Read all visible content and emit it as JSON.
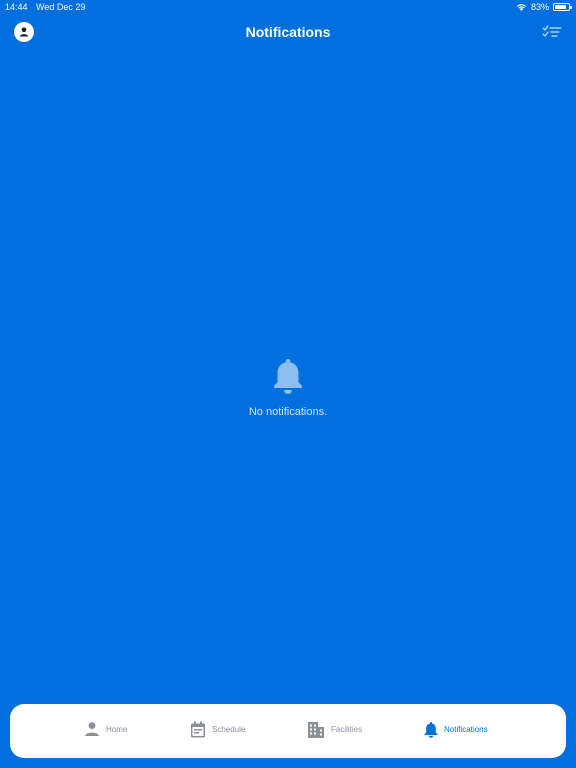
{
  "status_bar": {
    "time": "14:44",
    "date": "Wed Dec 29",
    "battery_text": "83%",
    "battery_level": 0.83,
    "wifi_icon": "wifi-icon"
  },
  "header": {
    "title": "Notifications",
    "left_icon": "profile-icon",
    "right_icon": "filter-checklist-icon"
  },
  "empty_state": {
    "icon": "bell-icon",
    "message": "No notifications."
  },
  "tabbar": {
    "tabs": [
      {
        "label": "Home",
        "icon": "person-icon",
        "active": false
      },
      {
        "label": "Schedule",
        "icon": "calendar-icon",
        "active": false
      },
      {
        "label": "Facilities",
        "icon": "building-icon",
        "active": false
      },
      {
        "label": "Notifications",
        "icon": "bell-icon",
        "active": true
      }
    ]
  },
  "colors": {
    "background": "#0170DE",
    "tab_active": "#0170DE",
    "tab_inactive": "#8A8F98",
    "tabbar_bg": "#FFFFFF"
  }
}
